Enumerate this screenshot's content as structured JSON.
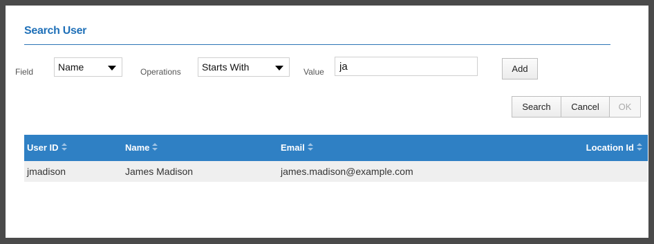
{
  "dialog": {
    "title": "Search User"
  },
  "filter": {
    "field_label": "Field",
    "field_value": "Name",
    "operations_label": "Operations",
    "operations_value": "Starts With",
    "value_label": "Value",
    "value_input": "ja",
    "add_label": "Add"
  },
  "actions": {
    "search_label": "Search",
    "cancel_label": "Cancel",
    "ok_label": "OK"
  },
  "table": {
    "columns": [
      "User ID",
      "Name",
      "Email",
      "Location Id"
    ],
    "rows": [
      {
        "user_id": "jmadison",
        "name": "James Madison",
        "email": "james.madison@example.com",
        "location_id": ""
      }
    ]
  },
  "colors": {
    "accent": "#1f70b8",
    "header_bg": "#2f80c4",
    "row_bg": "#efefef",
    "backdrop": "#4a4a4a"
  }
}
